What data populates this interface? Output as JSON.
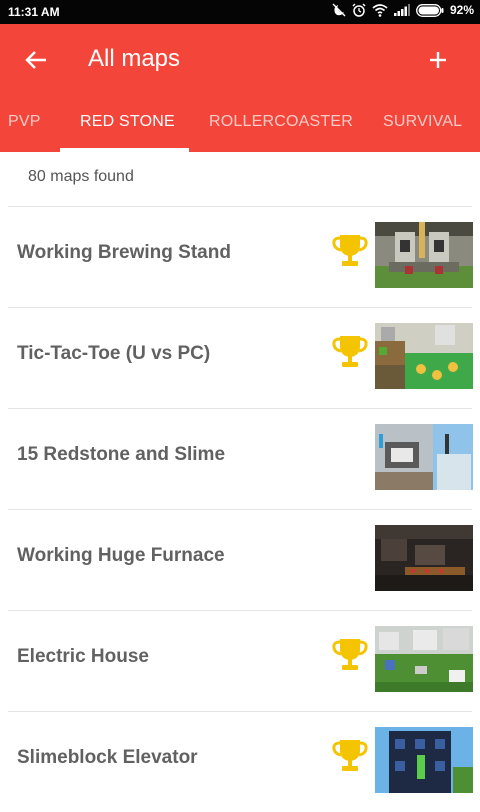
{
  "status": {
    "time": "11:31 AM",
    "battery": "92%"
  },
  "header": {
    "title": "All maps"
  },
  "tabs": [
    {
      "label": "PVP"
    },
    {
      "label": "RED STONE"
    },
    {
      "label": "ROLLERCOASTER"
    },
    {
      "label": "SURVIVAL"
    }
  ],
  "active_tab": "RED STONE",
  "results_count": "80 maps found",
  "maps": [
    {
      "title": "Working Brewing Stand",
      "featured": true
    },
    {
      "title": "Tic-Tac-Toe (U vs PC)",
      "featured": true
    },
    {
      "title": "15 Redstone and Slime",
      "featured": false
    },
    {
      "title": "Working Huge Furnace",
      "featured": false
    },
    {
      "title": "Electric House",
      "featured": true
    },
    {
      "title": "Slimeblock Elevator",
      "featured": true
    }
  ],
  "colors": {
    "app_bar": "#f4453a",
    "trophy": "#f5c400",
    "title_text": "#616161"
  }
}
